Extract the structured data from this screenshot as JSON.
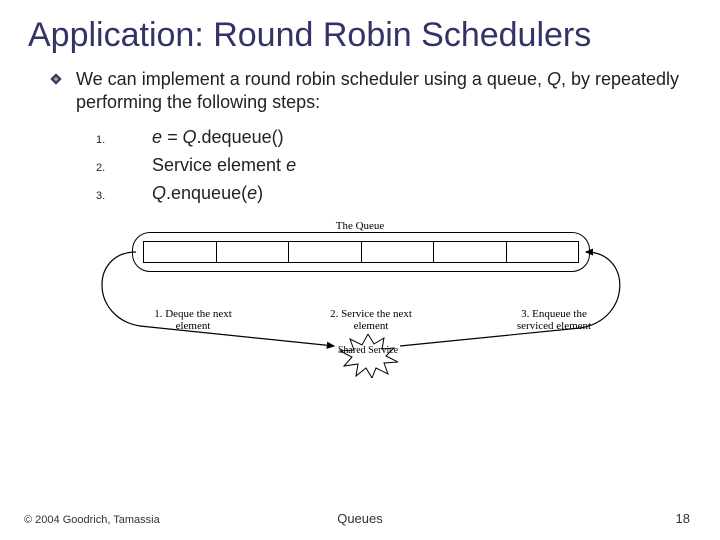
{
  "title": "Application: Round Robin Schedulers",
  "point": {
    "pre": "We can implement a round robin scheduler using a queue, ",
    "q": "Q",
    "post": ", by repeatedly performing the following steps:"
  },
  "steps": [
    {
      "num": "1.",
      "pre": "e = Q",
      "post": ".dequeue()"
    },
    {
      "num": "2.",
      "pre": "Service element ",
      "post": "e"
    },
    {
      "num": "3.",
      "pre": "Q",
      "mid": ".enqueue(",
      "arg": "e",
      "post": ")"
    }
  ],
  "diagram": {
    "queue_label": "The Queue",
    "captions": [
      "1. Deque the next element",
      "2. Service the next element",
      "3. Enqueue the serviced element"
    ],
    "service_label": "Shared Service"
  },
  "footer": {
    "copyright": "© 2004 Goodrich, Tamassia",
    "center": "Queues",
    "page": "18"
  }
}
